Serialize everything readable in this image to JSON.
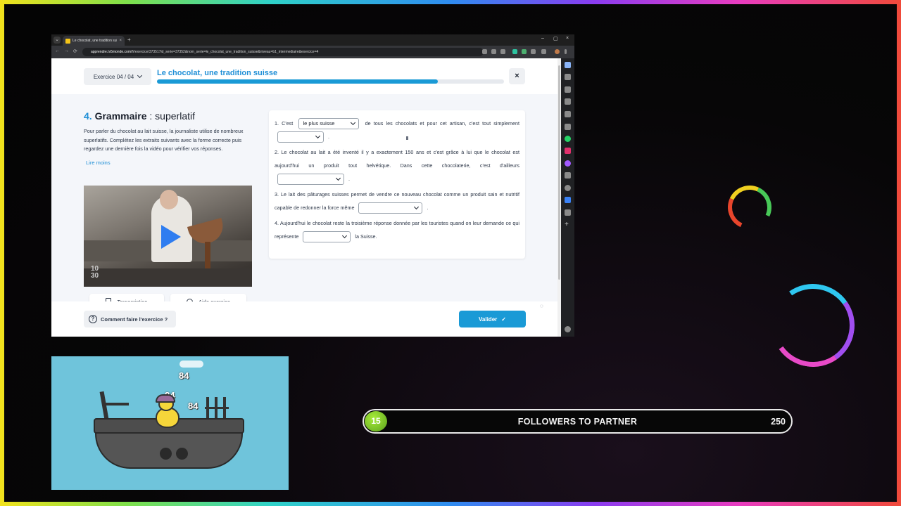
{
  "browser": {
    "tab_title": "Le chocolat, une tradition suisse",
    "tab_close": "×",
    "new_tab": "+",
    "url_domain": "apprendre.tv5monde.com",
    "url_path": "/fr/exercice/373517id_serie=37352&nom_serie=le_chocolat_une_tradition_suisse&niveau=b1_intermediaire&exercice=4",
    "window_controls": [
      "–",
      "▢",
      "×"
    ],
    "nav": [
      "←",
      "→",
      "⟳"
    ]
  },
  "exercise": {
    "selector_label": "Exercice 04 / 04",
    "title": "Le chocolat, une tradition suisse",
    "progress": 0.81,
    "close": "×"
  },
  "section": {
    "number": "4.",
    "name": "Grammaire",
    "topic": " : superlatif",
    "instructions": "Pour parler du chocolat au lait suisse, la journaliste utilise de nombreux superlatifs. Complétez les extraits suivants avec la forme correcte puis regardez une dernière fois la vidéo pour vérifier vos réponses.",
    "toggle": "Lire moins"
  },
  "video": {
    "replay_label": "10\n30"
  },
  "buttons": {
    "transcription": "Transcription",
    "aide": "Aide exercice",
    "help": "Comment faire l'exercice ?",
    "help_symbol": "?",
    "validate": "Valider",
    "validate_check": "✓"
  },
  "questions": {
    "q1_a": "1. C'est",
    "q1_select": "le plus suisse",
    "q1_b": "de tous les chocolats et pour cet artisan, c'est tout simplement",
    "q1_c": ".",
    "q2_a": "2. Le chocolat au lait a été inventé il y a exactement 150 ans et c'est grâce à lui que le chocolat est aujourd'hui un produit tout helvétique. Dans cette chocolaterie, c'est d'ailleurs",
    "q2_b": ".",
    "q3_a": "3. Le lait des pâturages suisses permet de vendre ce nouveau chocolat comme un produit sain et nutritif capable de redonner la force même",
    "q3_b": ".",
    "q4_a": "4. Aujourd'hui le chocolat reste la troisième réponse donnée par les touristes quand on leur demande ce qui représente",
    "q4_b": "la Suisse."
  },
  "game": {
    "counter_top": "84",
    "counter_mid": "84",
    "counter_right": "84"
  },
  "followers": {
    "count": "15",
    "label": "FOLLOWERS TO PARTNER",
    "goal": "250"
  },
  "colors": {
    "accent": "#1a9ad6",
    "title_blue": "#1f8fd6",
    "game_sky": "#6fc4db",
    "follower_badge": "#7fc92a"
  }
}
